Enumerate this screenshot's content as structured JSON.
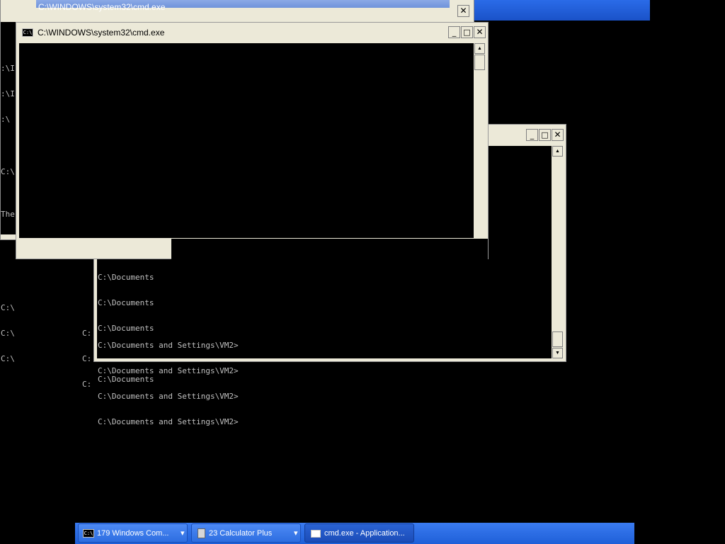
{
  "windows": {
    "back_top": {
      "title": "C:\\WINDOWS\\system32\\cmd.exe",
      "left_lines": [
        ":\\I",
        ":\\I",
        ":\\",
        "C:\\",
        "",
        "The",
        "",
        "",
        "C:\\",
        "C:\\",
        "C:\\"
      ]
    },
    "front": {
      "title": "C:\\WINDOWS\\system32\\cmd.exe"
    },
    "middle": {
      "lines_top": [
        "C:\\Documents",
        "C:\\Documents",
        "C:\\Documents",
        "",
        "C:\\Documents"
      ],
      "lines_bottom": [
        "C:\\Documents and Settings\\VM2>",
        "C:\\Documents and Settings\\VM2>",
        "C:\\Documents and Settings\\VM2>",
        "C:\\Documents and Settings\\VM2>"
      ],
      "stray_left": [
        "C:",
        "C:",
        "C:"
      ]
    }
  },
  "buttons": {
    "minimize": "_",
    "maximize": "□",
    "close": "✕"
  },
  "taskbar": {
    "items": [
      {
        "label": "179 Windows Com...",
        "icon": "cmd-icon"
      },
      {
        "label": "23 Calculator Plus",
        "icon": "calculator-icon"
      },
      {
        "label": "cmd.exe - Application...",
        "icon": "window-icon"
      }
    ],
    "dropdown_arrow": "▾"
  },
  "colors": {
    "xp_blue": "#1e5fd8",
    "xp_blue_light": "#3a7bf0",
    "window_frame": "#ece9d8",
    "console_bg": "#000000",
    "console_text": "#c0c0c0"
  }
}
